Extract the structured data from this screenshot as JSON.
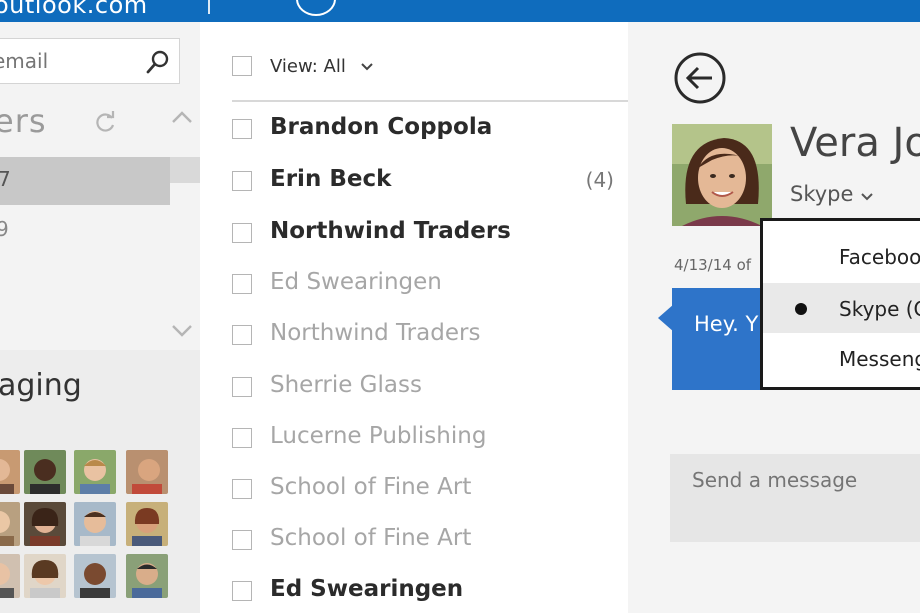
{
  "topbar": {
    "brand": "outlook.com"
  },
  "left": {
    "search": {
      "placeholder": "email"
    },
    "folders_title": "ers",
    "folder_rows": [
      {
        "count": "7"
      },
      {
        "count": "9"
      }
    ],
    "messaging_title": "aging"
  },
  "middle": {
    "view_label": "View: All",
    "mail": [
      {
        "sender": "Brandon Coppola",
        "unread": true,
        "count": ""
      },
      {
        "sender": "Erin Beck",
        "unread": true,
        "count": "(4)"
      },
      {
        "sender": "Northwind Traders",
        "unread": true,
        "count": ""
      },
      {
        "sender": "Ed Swearingen",
        "unread": false,
        "count": ""
      },
      {
        "sender": "Northwind Traders",
        "unread": false,
        "count": ""
      },
      {
        "sender": "Sherrie Glass",
        "unread": false,
        "count": ""
      },
      {
        "sender": "Lucerne Publishing",
        "unread": false,
        "count": ""
      },
      {
        "sender": "School of Fine Art",
        "unread": false,
        "count": ""
      },
      {
        "sender": "School of Fine Art",
        "unread": false,
        "count": ""
      },
      {
        "sender": "Ed Swearingen",
        "unread": true,
        "count": ""
      }
    ]
  },
  "right": {
    "contact_name": "Vera Jo",
    "service": "Skype",
    "message_date": "4/13/14 of",
    "message_text": "Hey. Y",
    "dropdown": [
      {
        "label": "Faceboo",
        "selected": false
      },
      {
        "label": "Skype (C",
        "selected": true
      },
      {
        "label": "Messeng",
        "selected": false
      }
    ],
    "compose_placeholder": "Send a message"
  },
  "colors": {
    "topbar": "#0f6cbd",
    "bubble": "#2e74c9"
  }
}
